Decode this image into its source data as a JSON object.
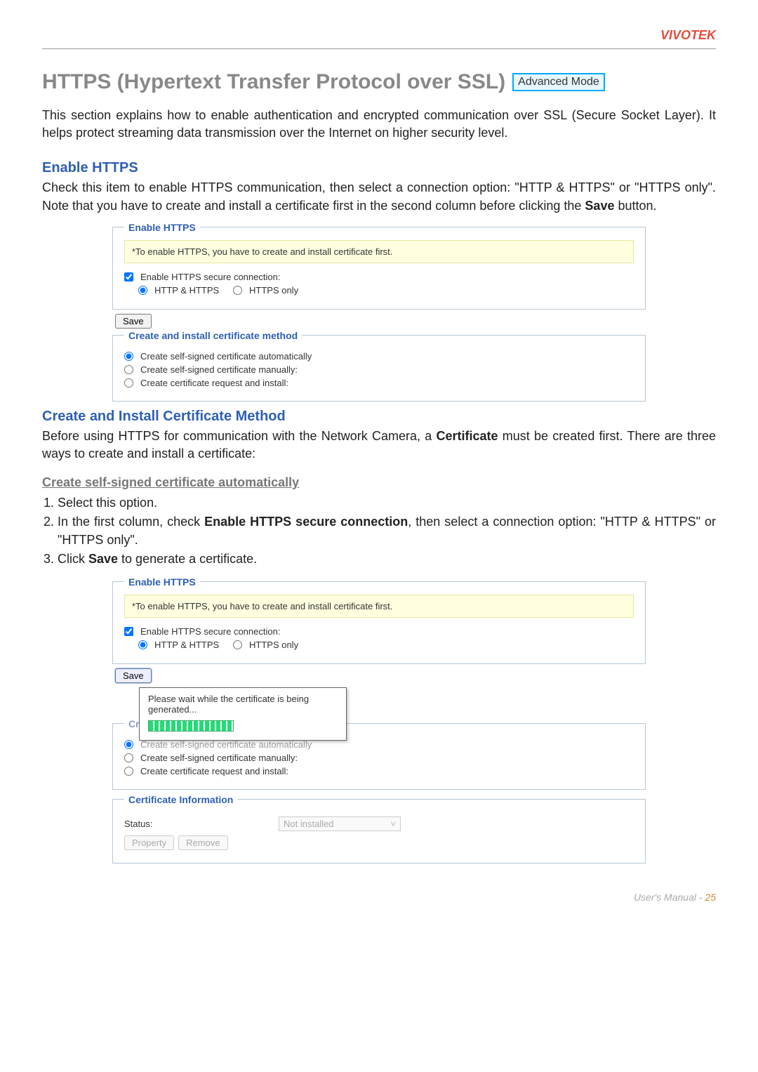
{
  "header": {
    "brand": "VIVOTEK"
  },
  "title": "HTTPS (Hypertext Transfer Protocol over SSL)",
  "adv_mode": "Advanced Mode",
  "intro": "This section explains how to enable authentication and encrypted communication over SSL (Secure Socket Layer). It helps protect streaming data transmission over the Internet on higher security level.",
  "enable_section": {
    "heading": "Enable HTTPS",
    "desc_pre": "Check this item to enable HTTPS communication, then select a connection option: \"HTTP & HTTPS\" or \"HTTPS only\". Note that you have to create and install a certificate first in the second column before clicking the ",
    "desc_bold": "Save",
    "desc_post": " button."
  },
  "ui1": {
    "fieldset_legend": "Enable HTTPS",
    "notice": "*To enable HTTPS, you have to create and install certificate first.",
    "checkbox_label": "Enable HTTPS secure connection:",
    "radio1": "HTTP & HTTPS",
    "radio2": "HTTPS only",
    "save_label": "Save",
    "cert_legend": "Create and install certificate method",
    "cert_opt1": "Create self-signed certificate automatically",
    "cert_opt2": "Create self-signed certificate manually:",
    "cert_opt3": "Create certificate request and install:"
  },
  "cert_method_section": {
    "heading": "Create and Install Certificate Method",
    "desc_pre": "Before using HTTPS for communication with the Network Camera, a ",
    "desc_bold": "Certificate",
    "desc_post": " must be created first. There are three ways to create and install a certificate:"
  },
  "auto_section": {
    "heading": "Create self-signed certificate automatically",
    "step1": "Select this option.",
    "step2_pre": "In the first column, check ",
    "step2_bold": "Enable HTTPS secure connection",
    "step2_mid": ", then select a connection option: \"HTTP & HTTPS\" or \"HTTPS only\".",
    "step3_pre": "Click ",
    "step3_bold": "Save",
    "step3_post": " to generate a certificate."
  },
  "ui2": {
    "fieldset_legend": "Enable HTTPS",
    "notice": "*To enable HTTPS, you have to create and install certificate first.",
    "checkbox_label": "Enable HTTPS secure connection:",
    "radio1": "HTTP & HTTPS",
    "radio2": "HTTPS only",
    "save_label": "Save",
    "popup_text": "Please wait while the certificate is being generated...",
    "cert_legend_partial": "Create and install certificate method",
    "cert_opt1": "Create self-signed certificate automatically",
    "cert_opt2": "Create self-signed certificate manually:",
    "cert_opt3": "Create certificate request and install:",
    "cert_info_legend": "Certificate Information",
    "status_label": "Status:",
    "status_value": "Not installed",
    "property_label": "Property",
    "remove_label": "Remove"
  },
  "footer": {
    "manual": "User's Manual - ",
    "page": "25"
  }
}
